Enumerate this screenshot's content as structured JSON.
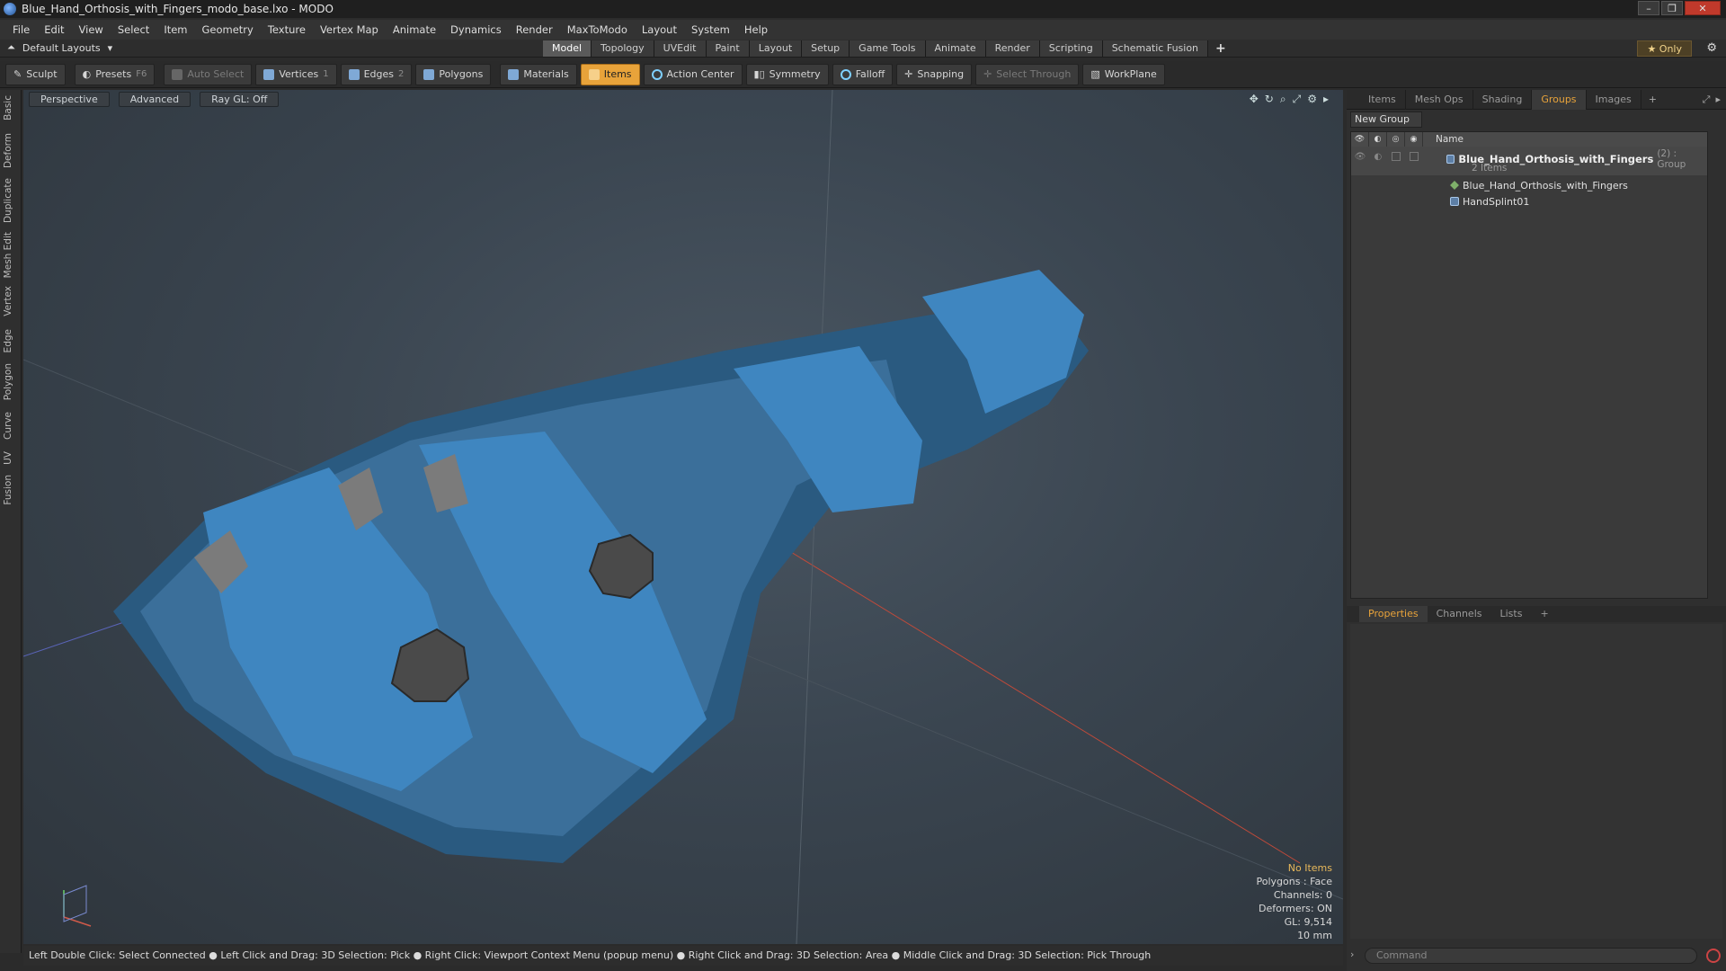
{
  "window": {
    "title": "Blue_Hand_Orthosis_with_Fingers_modo_base.lxo - MODO"
  },
  "menu": [
    "File",
    "Edit",
    "View",
    "Select",
    "Item",
    "Geometry",
    "Texture",
    "Vertex Map",
    "Animate",
    "Dynamics",
    "Render",
    "MaxToModo",
    "Layout",
    "System",
    "Help"
  ],
  "layout": {
    "preset": "Default Layouts",
    "tabs": [
      "Model",
      "Topology",
      "UVEdit",
      "Paint",
      "Layout",
      "Setup",
      "Game Tools",
      "Animate",
      "Render",
      "Scripting",
      "Schematic Fusion"
    ],
    "active_tab": "Model",
    "only_label": "Only"
  },
  "toolbar": {
    "sculpt": "Sculpt",
    "presets": "Presets",
    "presets_key": "F6",
    "auto_select": "Auto Select",
    "vertices": "Vertices",
    "vertices_count": "1",
    "edges": "Edges",
    "edges_count": "2",
    "polygons": "Polygons",
    "materials": "Materials",
    "items": "Items",
    "action_center": "Action Center",
    "symmetry": "Symmetry",
    "falloff": "Falloff",
    "snapping": "Snapping",
    "select_through": "Select Through",
    "workplane": "WorkPlane"
  },
  "left_tabs": [
    "Basic",
    "Deform",
    "Duplicate",
    "Mesh Edit",
    "Vertex",
    "Edge",
    "Polygon",
    "Curve",
    "UV",
    "Fusion"
  ],
  "viewport": {
    "view": "Perspective",
    "shading": "Advanced",
    "raygl": "Ray GL: Off",
    "info": {
      "selection": "No Items",
      "polygons": "Polygons : Face",
      "channels": "Channels: 0",
      "deformers": "Deformers: ON",
      "gl": "GL: 9,514",
      "unit": "10 mm"
    }
  },
  "status_bar": "Left Double Click: Select Connected ● Left Click and Drag: 3D Selection: Pick ● Right Click: Viewport Context Menu (popup menu) ● Right Click and Drag: 3D Selection: Area ● Middle Click and Drag: 3D Selection: Pick Through",
  "panel": {
    "tabs": [
      "Items",
      "Mesh Ops",
      "Shading",
      "Groups",
      "Images"
    ],
    "active_tab": "Groups",
    "new_group": "New Group",
    "name_header": "Name",
    "group_name": "Blue_Hand_Orthosis_with_Fingers",
    "group_suffix": "(2) : Group",
    "group_count": "2 Items",
    "children": [
      "Blue_Hand_Orthosis_with_Fingers",
      "HandSplint01"
    ]
  },
  "properties": {
    "tabs": [
      "Properties",
      "Channels",
      "Lists"
    ],
    "active_tab": "Properties"
  },
  "command": {
    "placeholder": "Command"
  },
  "colors": {
    "accent": "#e8a33a",
    "model_blue": "#3f7fb0",
    "model_dark": "#2a5a80"
  }
}
